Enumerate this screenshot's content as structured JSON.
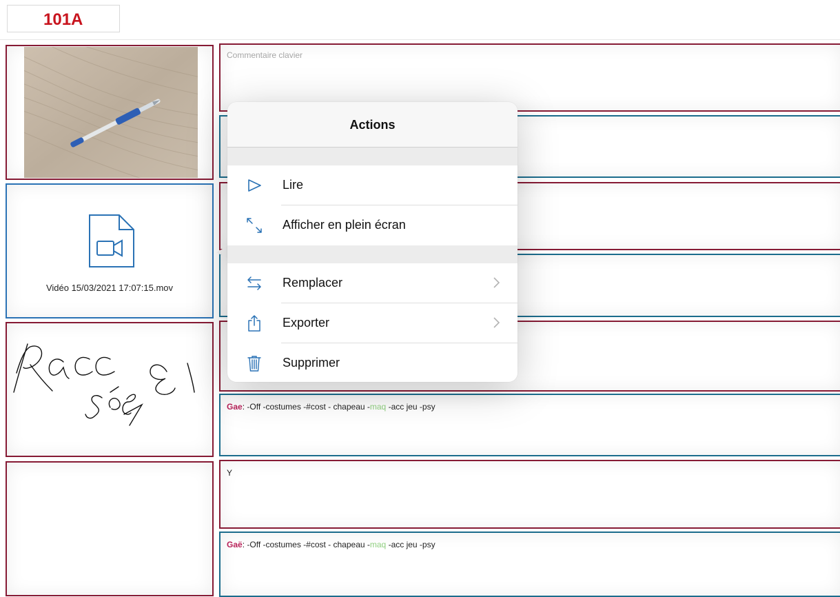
{
  "scene": {
    "id": "101A"
  },
  "grid": {
    "comment_placeholder": "Commentaire clavier",
    "video_filename": "Vidéo 15/03/2021 17:07:15.mov",
    "handwritten_note": "Racc 31 sé7",
    "row4_text": "Y",
    "notes": [
      {
        "name": "Gae",
        "sep": ":",
        "before": " -Off -costumes -#cost - chapeau -",
        "maq": "maq",
        "after": " -acc jeu -psy"
      },
      {
        "name": "Gaë",
        "sep": ":",
        "before": " -Off -costumes -#cost - chapeau -",
        "maq": "maq",
        "after": " -acc jeu -psy"
      }
    ]
  },
  "popover": {
    "title": "Actions",
    "groups": [
      [
        {
          "label": "Lire",
          "icon": "play-icon"
        },
        {
          "label": "Afficher en plein écran",
          "icon": "fullscreen-icon"
        }
      ],
      [
        {
          "label": "Remplacer",
          "icon": "swap-arrows-icon",
          "submenu": true
        },
        {
          "label": "Exporter",
          "icon": "share-icon",
          "submenu": true
        },
        {
          "label": "Supprimer",
          "icon": "trash-icon"
        }
      ]
    ]
  },
  "colors": {
    "accent_blue": "#2a72b5",
    "scene_red": "#c8141e",
    "cell_border_red": "#861a34",
    "cell_border_blue": "#1b6c8c"
  }
}
